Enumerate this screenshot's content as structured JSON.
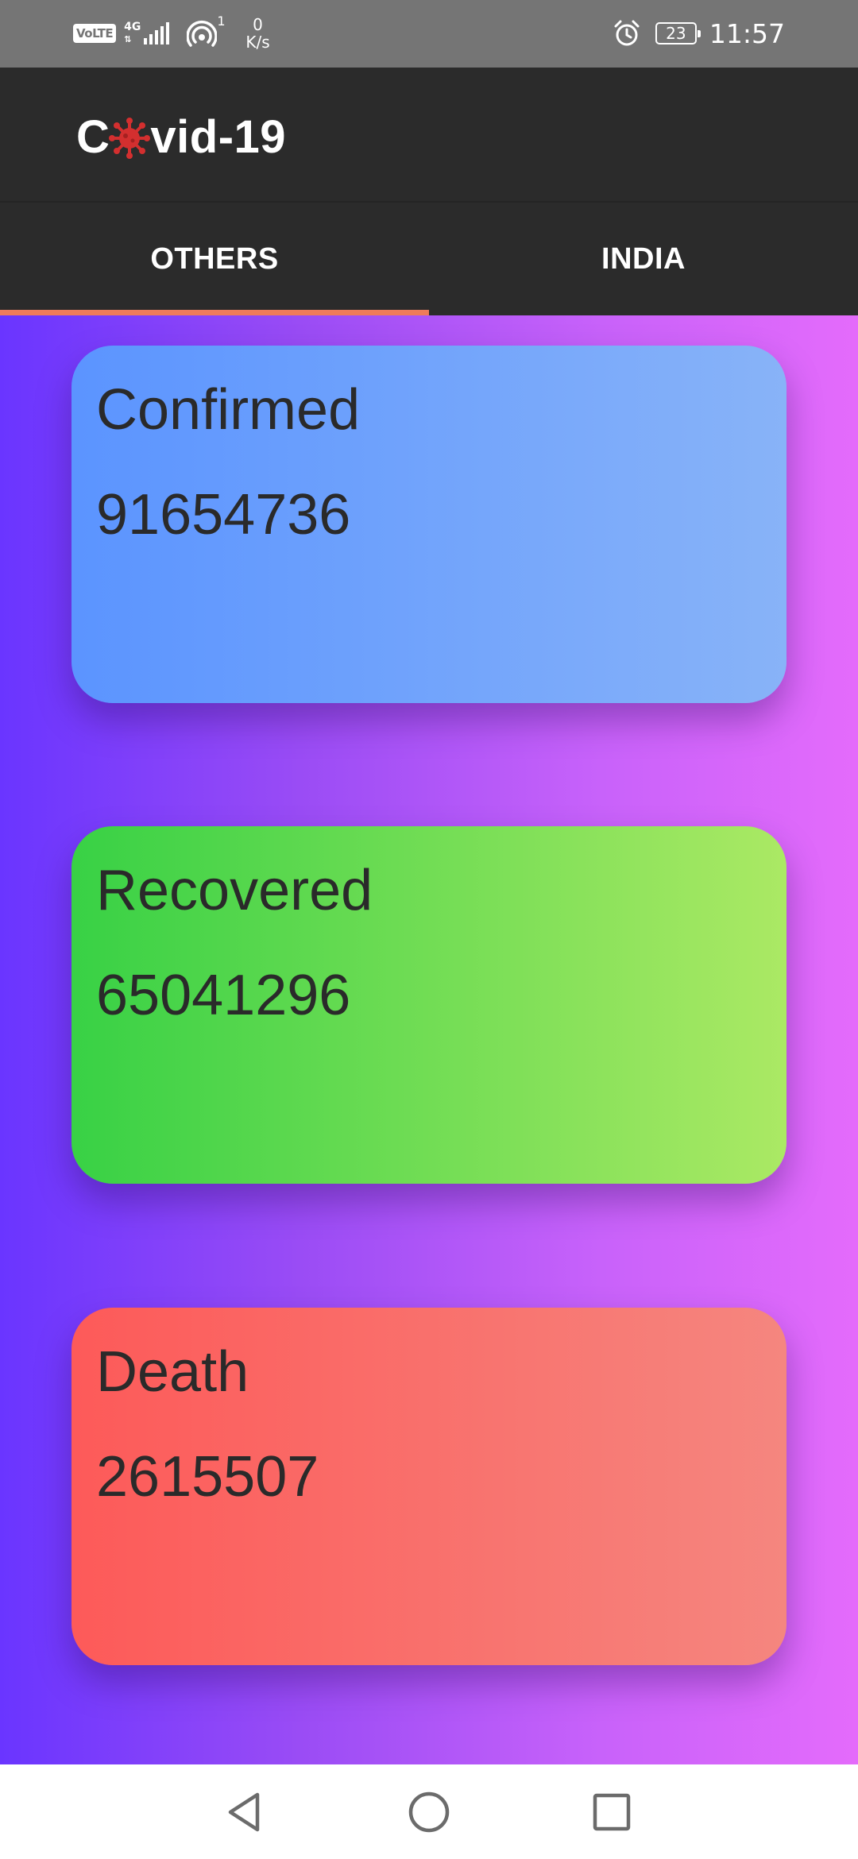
{
  "status_bar": {
    "volte": "VoLTE",
    "network": "4G",
    "hotspot_count": "1",
    "speed_value": "0",
    "speed_unit": "K/s",
    "battery": "23",
    "time": "11:57"
  },
  "app_bar": {
    "title_prefix": "C",
    "title_suffix": "vid-19",
    "virus_color": "#d32f2f"
  },
  "tabs": [
    {
      "label": "OTHERS",
      "selected": true
    },
    {
      "label": "INDIA",
      "selected": false
    }
  ],
  "colors": {
    "tab_indicator": "#ef7b5b",
    "background_gradient": [
      "#6a35ff",
      "#e46bfb"
    ],
    "confirmed": [
      "#5b94ff",
      "#88b3f8"
    ],
    "recovered": [
      "#38d145",
      "#abe964"
    ],
    "death": [
      "#fd5a59",
      "#f5867f"
    ]
  },
  "cards": [
    {
      "label": "Confirmed",
      "value": "91654736"
    },
    {
      "label": "Recovered",
      "value": "65041296"
    },
    {
      "label": "Death",
      "value": "2615507"
    }
  ],
  "nav": {
    "back": "back-icon",
    "home": "home-icon",
    "recents": "recents-icon"
  }
}
